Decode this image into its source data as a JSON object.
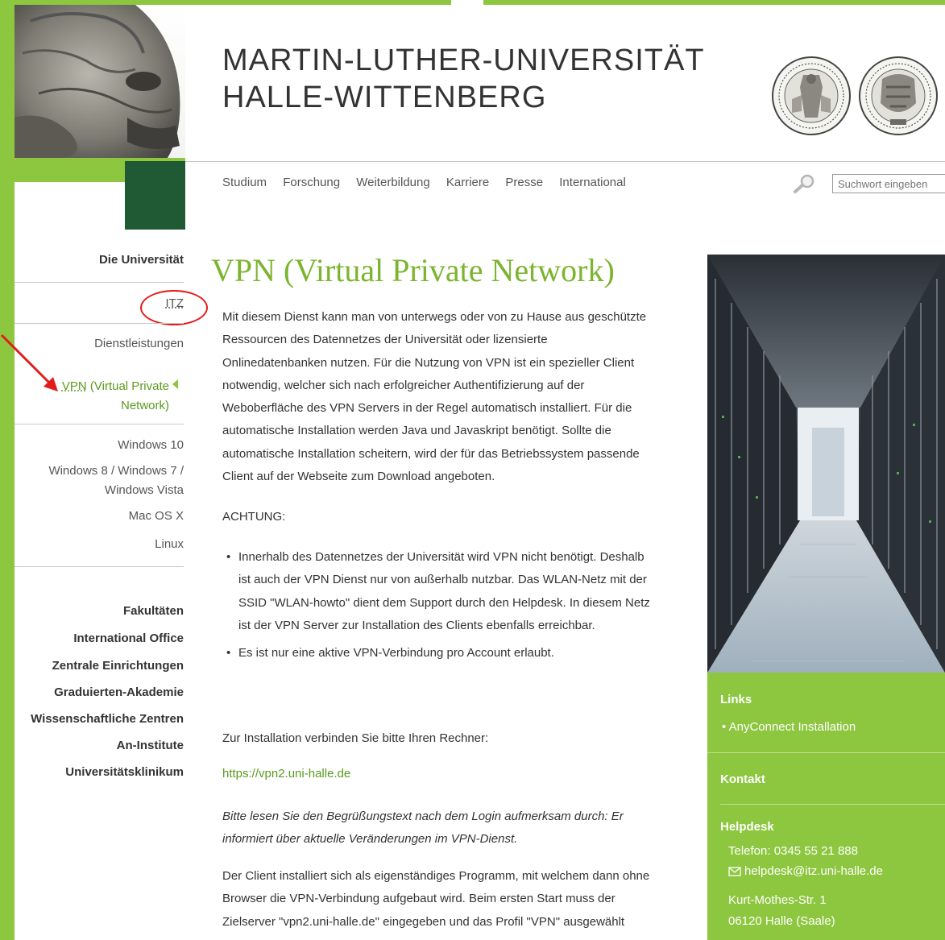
{
  "header": {
    "title_line1": "MARTIN-LUTHER-UNIVERSITÄT",
    "title_line2": "HALLE-WITTENBERG"
  },
  "topnav": [
    "Studium",
    "Forschung",
    "Weiterbildung",
    "Karriere",
    "Presse",
    "International"
  ],
  "search": {
    "placeholder": "Suchwort eingeben"
  },
  "sidebar": {
    "section_title": "Die Universität",
    "itz": "ITZ",
    "dienstleistungen": "Dienstleistungen",
    "vpn_line1_abbr": "VPN",
    "vpn_line1_rest": " (Virtual Private",
    "vpn_line2": "Network)",
    "sub_items": [
      "Windows 10",
      "Windows 8 / Windows 7 /",
      "Windows Vista",
      "Mac OS X",
      "Linux"
    ],
    "bottom_items": [
      "Fakultäten",
      "International Office",
      "Zentrale Einrichtungen",
      "Graduierten-Akademie",
      "Wissenschaftliche Zentren",
      "An-Institute",
      "Universitätsklinikum"
    ]
  },
  "main": {
    "title": "VPN (Virtual Private Network)",
    "intro_lines": [
      "Mit diesem Dienst kann man von unterwegs oder von zu Hause aus geschützte",
      "Ressourcen des Datennetzes der Universität oder lizensierte",
      "Onlinedatenbanken nutzen. Für die Nutzung von VPN ist ein spezieller Client",
      "notwendig, welcher sich nach erfolgreicher Authentifizierung auf der",
      "Weboberfläche des VPN Servers in der Regel automatisch installiert. Für die",
      "automatische Installation werden Java und Javaskript benötigt. Sollte die",
      "automatische Installation scheitern, wird der für das Betriebssystem passende",
      "Client auf der Webseite zum Download angeboten."
    ],
    "achtung": "ACHTUNG:",
    "bullet1_lines": [
      "Innerhalb des Datennetzes der Universität wird VPN nicht benötigt. Deshalb",
      "ist auch der VPN Dienst nur von außerhalb nutzbar. Das WLAN-Netz mit der",
      "SSID \"WLAN-howto\" dient dem Support durch den Helpdesk. In diesem Netz",
      "ist der VPN Server zur Installation des Clients ebenfalls erreichbar."
    ],
    "bullet2": "Es ist nur eine aktive VPN-Verbindung pro Account erlaubt.",
    "install_text": "Zur Installation verbinden Sie bitte Ihren Rechner:",
    "install_link": "https://vpn2.uni-halle.de",
    "italic_lines": [
      "Bitte lesen Sie den Begrüßungstext nach dem Login aufmerksam durch: Er",
      "informiert über aktuelle Veränderungen im VPN-Dienst."
    ],
    "client_lines": [
      "Der Client installiert sich als eigenständiges Programm, mit welchem dann ohne",
      "Browser die VPN-Verbindung aufgebaut wird. Beim ersten Start muss der",
      "Zielserver \"vpn2.uni-halle.de\" eingegeben und das Profil \"VPN\" ausgewählt"
    ]
  },
  "right": {
    "links_title": "Links",
    "links_item": "AnyConnect Installation",
    "kontakt_title": "Kontakt",
    "helpdesk_title": "Helpdesk",
    "telefon": "Telefon: 0345 55 21 888",
    "email": "helpdesk@itz.uni-halle.de",
    "street": "Kurt-Mothes-Str. 1",
    "city": "06120 Halle (Saale)"
  },
  "colors": {
    "brand_green": "#8dc63f",
    "dark_green": "#1f5a34",
    "annotation_red": "#e31b1b"
  }
}
